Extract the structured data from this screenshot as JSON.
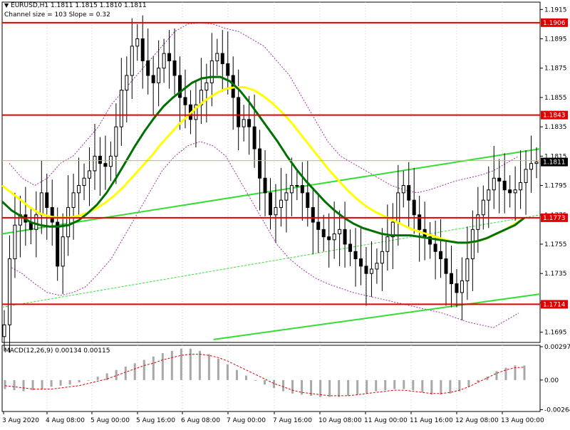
{
  "header": {
    "symbol_line": "EURUSD,H1  1.1811 1.1815 1.1810 1.1811",
    "channel_line": "Channel size = 103 Slope = 0.32",
    "macd_label": "MACD(12,26,9) 0.00134 0.00115"
  },
  "chart_data": [
    {
      "type": "candlestick",
      "title": "EURUSD,H1",
      "ohlc_current": {
        "open": 1.1811,
        "high": 1.1815,
        "low": 1.181,
        "close": 1.1811
      },
      "ylim": [
        1.1688,
        1.192
      ],
      "y_ticks": [
        "1.1915",
        "1.1895",
        "1.1875",
        "1.1855",
        "1.1835",
        "1.1815",
        "1.1795",
        "1.1775",
        "1.1755",
        "1.1735",
        "1.1715",
        "1.1695"
      ],
      "x_ticks": [
        "3 Aug 2020",
        "4 Aug 08:00",
        "5 Aug 00:00",
        "5 Aug 16:00",
        "6 Aug 08:00",
        "7 Aug 00:00",
        "7 Aug 16:00",
        "10 Aug 08:00",
        "11 Aug 00:00",
        "11 Aug 16:00",
        "12 Aug 08:00",
        "13 Aug 00:00"
      ],
      "current_price_label": "1.1811",
      "horizontal_levels": [
        {
          "label": "1.1906",
          "value": 1.1906,
          "color": "#e00000"
        },
        {
          "label": "1.1843",
          "value": 1.1843,
          "color": "#e00000"
        },
        {
          "label": "1.1773",
          "value": 1.1773,
          "color": "#e00000"
        },
        {
          "label": "1.1714",
          "value": 1.1714,
          "color": "#e00000"
        }
      ],
      "close_series": [
        1.17,
        1.1745,
        1.1768,
        1.1775,
        1.177,
        1.1765,
        1.1775,
        1.179,
        1.178,
        1.177,
        1.174,
        1.176,
        1.178,
        1.179,
        1.1795,
        1.18,
        1.1805,
        1.1815,
        1.181,
        1.1808,
        1.1815,
        1.1835,
        1.186,
        1.187,
        1.189,
        1.1895,
        1.188,
        1.187,
        1.1865,
        1.1875,
        1.1885,
        1.188,
        1.187,
        1.1855,
        1.185,
        1.184,
        1.185,
        1.186,
        1.1865,
        1.188,
        1.1885,
        1.1878,
        1.187,
        1.1855,
        1.1835,
        1.184,
        1.1835,
        1.182,
        1.18,
        1.179,
        1.1775,
        1.178,
        1.1785,
        1.179,
        1.1795,
        1.1795,
        1.179,
        1.178,
        1.177,
        1.1765,
        1.176,
        1.1758,
        1.1762,
        1.1765,
        1.1755,
        1.175,
        1.1745,
        1.174,
        1.1735,
        1.1738,
        1.1742,
        1.175,
        1.176,
        1.177,
        1.179,
        1.1795,
        1.1785,
        1.1775,
        1.1765,
        1.176,
        1.1755,
        1.175,
        1.1745,
        1.1735,
        1.1728,
        1.1722,
        1.173,
        1.1745,
        1.1765,
        1.1775,
        1.1785,
        1.1792,
        1.18,
        1.1798,
        1.1792,
        1.179,
        1.1792,
        1.1797,
        1.1806,
        1.181,
        1.1811
      ],
      "series": [
        {
          "name": "",
          "color": "#ffff00",
          "start": 0,
          "values": [
            1.1795,
            1.179,
            1.1785,
            1.178,
            1.1776,
            1.1774,
            1.1773,
            1.1773,
            1.1774,
            1.1776,
            1.1779,
            1.1783,
            1.1788,
            1.1794,
            1.1801,
            1.1808,
            1.1815,
            1.1823,
            1.183,
            1.1837,
            1.1843,
            1.1849,
            1.1854,
            1.1858,
            1.1861,
            1.1862,
            1.1862,
            1.186,
            1.1856,
            1.1851,
            1.1845,
            1.1838,
            1.183,
            1.1822,
            1.1814,
            1.1806,
            1.1799,
            1.1792,
            1.1786,
            1.1781,
            1.1777,
            1.1774,
            1.1771,
            1.1768,
            1.1765,
            1.1763,
            1.1761,
            1.1759,
            1.1757,
            1.1756,
            1.1756,
            1.1757,
            1.1759,
            1.1762,
            1.1765,
            1.1769,
            1.1773
          ]
        },
        {
          "name": "",
          "color": "#007000",
          "start": 0,
          "values": [
            1.1784,
            1.1778,
            1.1774,
            1.177,
            1.1768,
            1.1767,
            1.1767,
            1.1768,
            1.1771,
            1.1776,
            1.1782,
            1.179,
            1.18,
            1.1811,
            1.1822,
            1.1832,
            1.1841,
            1.1849,
            1.1855,
            1.186,
            1.1865,
            1.1868,
            1.1869,
            1.1869,
            1.1866,
            1.186,
            1.1852,
            1.1843,
            1.1834,
            1.1825,
            1.1815,
            1.1806,
            1.1798,
            1.1791,
            1.1784,
            1.1778,
            1.1773,
            1.1769,
            1.1766,
            1.1764,
            1.1762,
            1.1761,
            1.1761,
            1.1761,
            1.176,
            1.1759,
            1.1758,
            1.1757,
            1.1756,
            1.1756,
            1.1757,
            1.1759,
            1.1762,
            1.1765,
            1.1768,
            1.1773
          ]
        }
      ],
      "trendlines": [
        {
          "from": [
            0,
            1.1762
          ],
          "to": [
            56,
            1.182
          ],
          "color": "#33dd33"
        },
        {
          "from": [
            22,
            1.169
          ],
          "to": [
            56,
            1.1721
          ],
          "color": "#33dd33"
        },
        {
          "from": [
            0,
            1.1712
          ],
          "to": [
            56,
            1.1775
          ],
          "color": "#33dd33",
          "dashed": true
        }
      ],
      "channel_bands": [
        {
          "color": "#a030a0",
          "values": [
            1.181,
            1.18,
            1.1795,
            1.18,
            1.181,
            1.1815,
            1.1825,
            1.1835,
            1.185,
            1.186,
            1.187,
            1.188,
            1.189,
            1.19,
            1.1905,
            1.1906,
            1.1905,
            1.1902,
            1.19,
            1.1895,
            1.189,
            1.188,
            1.187,
            1.1855,
            1.184,
            1.1825,
            1.1815,
            1.181,
            1.1805,
            1.18,
            1.1795,
            1.1792,
            1.179,
            1.1792,
            1.1795,
            1.1798,
            1.18,
            1.1802,
            1.1805,
            1.181,
            1.1815
          ]
        },
        {
          "color": "#a030a0",
          "values": [
            1.174,
            1.1735,
            1.1728,
            1.1722,
            1.172,
            1.1722,
            1.1726,
            1.1735,
            1.1745,
            1.176,
            1.1775,
            1.179,
            1.1805,
            1.1815,
            1.1822,
            1.1825,
            1.1822,
            1.1815,
            1.18,
            1.1785,
            1.177,
            1.1755,
            1.1745,
            1.1738,
            1.1732,
            1.1728,
            1.1725,
            1.1722,
            1.172,
            1.1718,
            1.1716,
            1.1714,
            1.1712,
            1.171,
            1.1708,
            1.1705,
            1.1702,
            1.17,
            1.1698,
            1.1703,
            1.1708
          ]
        }
      ]
    },
    {
      "type": "bar",
      "title": "MACD(12,26,9) 0.00134 0.00115",
      "ylim": [
        -0.0028,
        0.0031
      ],
      "y_ticks": [
        "0.00297",
        "0.00",
        "-0.00264"
      ],
      "histogram": [
        -0.0008,
        -0.0009,
        -0.001,
        -0.0009,
        -0.0008,
        -0.0006,
        -0.0005,
        -0.0004,
        -0.0002,
        0.0,
        0.0003,
        0.0006,
        0.0009,
        0.0012,
        0.0015,
        0.0018,
        0.0021,
        0.0024,
        0.0026,
        0.0028,
        0.0028,
        0.0026,
        0.0023,
        0.0019,
        0.0014,
        0.0009,
        0.0004,
        0.0,
        -0.0004,
        -0.0007,
        -0.001,
        -0.0012,
        -0.0013,
        -0.0014,
        -0.0015,
        -0.0015,
        -0.0015,
        -0.0014,
        -0.0013,
        -0.0012,
        -0.001,
        -0.0009,
        -0.0008,
        -0.0008,
        -0.0009,
        -0.0011,
        -0.0013,
        -0.0013,
        -0.0012,
        -0.001,
        -0.0006,
        -0.0002,
        0.0003,
        0.0008,
        0.0011,
        0.0013,
        0.0013
      ],
      "signal": [
        -0.0005,
        -0.0006,
        -0.0007,
        -0.0008,
        -0.0008,
        -0.0008,
        -0.0007,
        -0.0006,
        -0.0005,
        -0.0003,
        -0.0001,
        0.0001,
        0.0004,
        0.0007,
        0.001,
        0.0013,
        0.0015,
        0.0018,
        0.002,
        0.0022,
        0.0023,
        0.0023,
        0.0022,
        0.002,
        0.0017,
        0.0013,
        0.0009,
        0.0005,
        0.0001,
        -0.0003,
        -0.0006,
        -0.0009,
        -0.0011,
        -0.0012,
        -0.0013,
        -0.0014,
        -0.0014,
        -0.0014,
        -0.0013,
        -0.0012,
        -0.0011,
        -0.001,
        -0.0009,
        -0.0009,
        -0.001,
        -0.0011,
        -0.0012,
        -0.0012,
        -0.0011,
        -0.0009,
        -0.0006,
        -0.0002,
        0.0002,
        0.0006,
        0.0009,
        0.0011,
        0.00115
      ]
    }
  ]
}
